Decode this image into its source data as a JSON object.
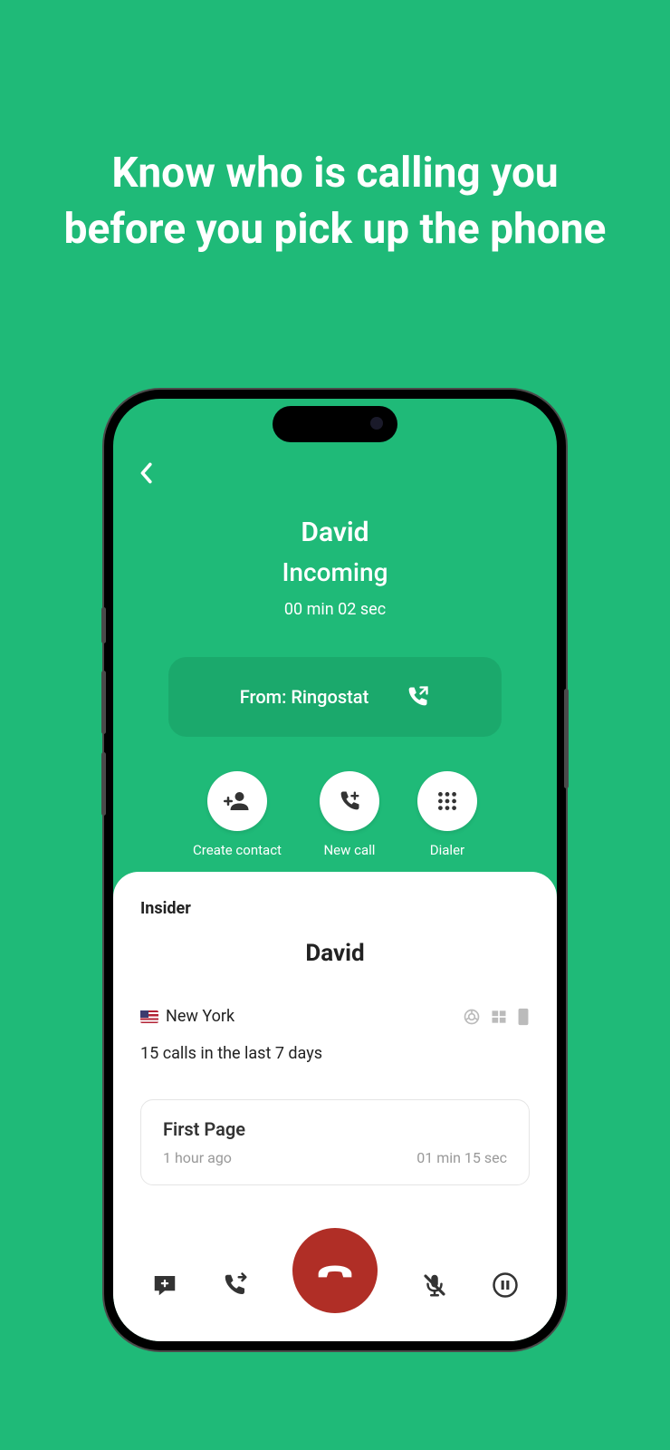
{
  "headline": "Know who is calling you before you pick up the phone",
  "call": {
    "caller_name": "David",
    "status": "Incoming",
    "duration": "00 min 02 sec",
    "from_label": "From: Ringostat"
  },
  "actions": {
    "create_contact": "Create contact",
    "new_call": "New call",
    "dialer": "Dialer"
  },
  "insider": {
    "title": "Insider",
    "name": "David",
    "location": "New York",
    "calls_summary": "15 calls in the last 7 days",
    "first_page": {
      "title": "First Page",
      "time_ago": "1 hour ago",
      "duration": "01 min 15 sec"
    }
  }
}
